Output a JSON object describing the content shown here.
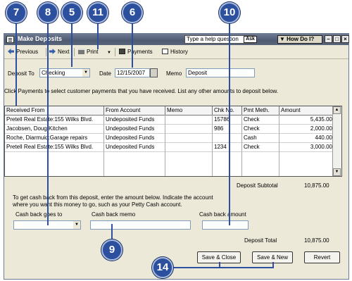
{
  "window": {
    "title": "Make Deposits",
    "help_placeholder": "Type a help question",
    "ask_label": "Ask",
    "how_do_i_label": "How Do I?"
  },
  "toolbar": {
    "previous": "Previous",
    "next": "Next",
    "print": "Print",
    "payments": "Payments",
    "history": "History"
  },
  "form": {
    "deposit_to_label": "Deposit To",
    "deposit_to_value": "Checking",
    "date_label": "Date",
    "date_value": "12/15/2007",
    "memo_label": "Memo",
    "memo_value": "Deposit",
    "instructions": "Click Payments to select customer payments that you have received. List any other amounts to deposit below."
  },
  "table": {
    "columns": [
      "Received From",
      "From Account",
      "Memo",
      "Chk No.",
      "Pmt Meth.",
      "Amount"
    ],
    "rows": [
      [
        "Pretell Real Estate:155 Wilks Blvd.",
        "Undeposited Funds",
        "",
        "15786",
        "Check",
        "5,435.00"
      ],
      [
        "Jacobsen, Doug:Kitchen",
        "Undeposited Funds",
        "",
        "986",
        "Check",
        "2,000.00"
      ],
      [
        "Roche, Diarmuid:Garage repairs",
        "Undeposited Funds",
        "",
        "",
        "Cash",
        "440.00"
      ],
      [
        "Pretell Real Estate:155 Wilks Blvd.",
        "Undeposited Funds",
        "",
        "1234",
        "Check",
        "3,000.00"
      ]
    ]
  },
  "subtotal": {
    "label": "Deposit Subtotal",
    "value": "10,875.00"
  },
  "cashback": {
    "instructions_line1": "To get cash back from this deposit, enter the amount below.  Indicate the account",
    "instructions_line2": "where you want this money to go, such as your Petty Cash account.",
    "goes_to_label": "Cash back goes to",
    "goes_to_value": "",
    "memo_label": "Cash back memo",
    "memo_value": "",
    "amount_label": "Cash back amount",
    "amount_value": ""
  },
  "total": {
    "label": "Deposit Total",
    "value": "10,875.00"
  },
  "buttons": {
    "save_close": "Save & Close",
    "save_new": "Save & New",
    "revert": "Revert"
  },
  "callouts": [
    "7",
    "8",
    "5",
    "11",
    "6",
    "10",
    "9",
    "14"
  ],
  "colors": {
    "callout": "#2c4f9e",
    "titlebar": "#4e5a70",
    "window_bg": "#ece9d8"
  }
}
